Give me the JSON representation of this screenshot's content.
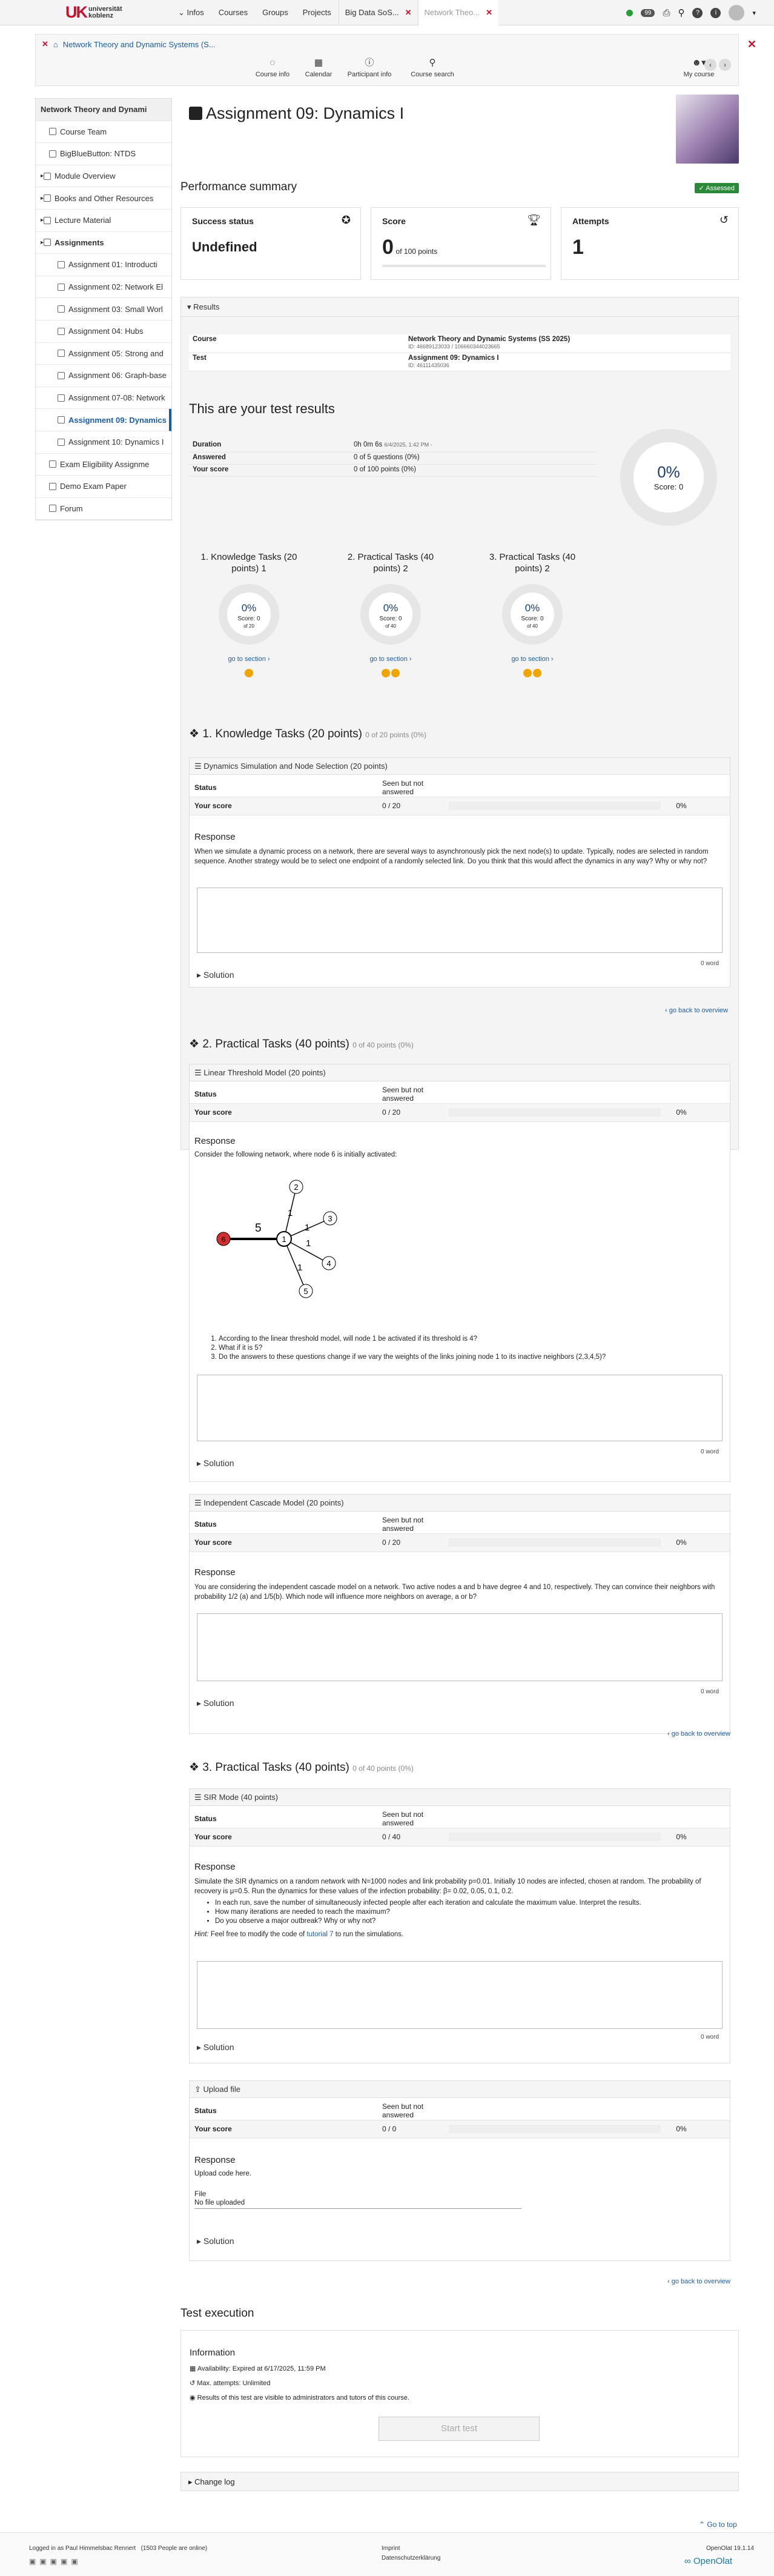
{
  "topbar": {
    "logo_mark": "UK",
    "logo_line1": "universität",
    "logo_line2": "koblenz",
    "nav": [
      "Infos",
      "Courses",
      "Groups",
      "Projects"
    ],
    "tabs": [
      "Big Data SoS...",
      "Network Theo..."
    ],
    "count_badge": "99"
  },
  "crumb": {
    "title": "Network Theory and Dynamic Systems (S..."
  },
  "tools": [
    {
      "icon": "bulb-icon",
      "label": "Course info"
    },
    {
      "icon": "calendar-icon",
      "label": "Calendar"
    },
    {
      "icon": "info-icon",
      "label": "Participant info"
    },
    {
      "icon": "search-icon",
      "label": "Course search"
    }
  ],
  "my_course": "My course",
  "sidebar": [
    {
      "label": "Network Theory and Dynami",
      "indent": 0,
      "head": true
    },
    {
      "label": "Course Team",
      "indent": 1
    },
    {
      "label": "BigBlueButton: NTDS",
      "indent": 1
    },
    {
      "label": "Module Overview",
      "indent": 0,
      "arrow": true
    },
    {
      "label": "Books and Other Resources",
      "indent": 0,
      "arrow": true
    },
    {
      "label": "Lecture Material",
      "indent": 0,
      "arrow": true
    },
    {
      "label": "Assignments",
      "indent": 0,
      "arrow": true,
      "bold": true
    },
    {
      "label": "Assignment 01: Introducti",
      "indent": 2
    },
    {
      "label": "Assignment 02: Network El",
      "indent": 2
    },
    {
      "label": "Assignment 03: Small Worl",
      "indent": 2
    },
    {
      "label": "Assignment 04: Hubs",
      "indent": 2
    },
    {
      "label": "Assignment 05: Strong and",
      "indent": 2
    },
    {
      "label": "Assignment 06: Graph-base",
      "indent": 2
    },
    {
      "label": "Assignment 07-08: Network",
      "indent": 2
    },
    {
      "label": "Assignment 09: Dynamics I",
      "indent": 2,
      "active": true
    },
    {
      "label": "Assignment 10: Dynamics I",
      "indent": 2
    },
    {
      "label": "Exam Eligibility Assignme",
      "indent": 1
    },
    {
      "label": "Demo Exam Paper",
      "indent": 1
    },
    {
      "label": "Forum",
      "indent": 1
    }
  ],
  "page": {
    "title": "Assignment 09: Dynamics I",
    "perf_summary": "Performance summary",
    "assessed": "✓ Assessed",
    "success_label": "Success status",
    "success_value": "Undefined",
    "score_label": "Score",
    "score_value": "0",
    "score_of": "of 100 points",
    "attempts_label": "Attempts",
    "attempts_value": "1",
    "results_label": "Results",
    "course_k": "Course",
    "course_v": "Network Theory and Dynamic Systems (SS 2025)",
    "course_id": "ID: 46689123033 / 106660344023665",
    "test_k": "Test",
    "test_v": "Assignment 09: Dynamics I",
    "test_id": "ID: 46111435036",
    "your_results": "This are your test results",
    "duration_k": "Duration",
    "duration_v": "0h 0m 6s",
    "duration_d": "6/4/2025, 1:42 PM -",
    "answered_k": "Answered",
    "answered_v": "0 of 5 questions (0%)",
    "yourscore_k": "Your score",
    "yourscore_v": "0 of 100 points (0%)",
    "big_pct": "0%",
    "big_score": "Score: 0"
  },
  "sections": [
    {
      "title": "1. Knowledge Tasks (20 points) 1",
      "pct": "0%",
      "score": "Score: 0",
      "of": "of 20",
      "link": "go to section",
      "dots": 1
    },
    {
      "title": "2. Practical Tasks (40 points) 2",
      "pct": "0%",
      "score": "Score: 0",
      "of": "of 40",
      "link": "go to section",
      "dots": 2
    },
    {
      "title": "3. Practical Tasks (40 points) 2",
      "pct": "0%",
      "score": "Score: 0",
      "of": "of 40",
      "link": "go to section",
      "dots": 2
    }
  ],
  "common": {
    "status_k": "Status",
    "status_v": "Seen but not answered",
    "yourscore_k": "Your score",
    "pct": "0%",
    "response": "Response",
    "words": "0 word",
    "solution": "Solution",
    "back": "go back to overview"
  },
  "s1": {
    "title": "1. Knowledge Tasks (20 points)",
    "sub": "0 of 20 points (0%)",
    "q1_title": "Dynamics Simulation and Node Selection (20 points)",
    "q1_score": "0 / 20",
    "q1_text": "When we simulate a dynamic process on a network, there are several ways to asynchronously pick the next node(s) to update. Typically, nodes are selected in random sequence. Another strategy would be to select one endpoint of a randomly selected link. Do you think that this would affect the dynamics in any way? Why or why not?"
  },
  "s2": {
    "title": "2. Practical Tasks (40 points)",
    "sub": "0 of 40 points (0%)",
    "q2_title": "Linear Threshold Model (20 points)",
    "q2_score": "0 / 20",
    "q2_text": "Consider the following network, where node 6 is initially activated:",
    "graph": {
      "edge_a": "5",
      "edge_b": "1",
      "edge_c": "1",
      "edge_d": "1",
      "edge_e": "1",
      "n1": "1",
      "n2": "2",
      "n3": "3",
      "n4": "4",
      "n5": "5",
      "n6": "6"
    },
    "q2_list": [
      "According to the linear threshold model, will node 1 be activated if its threshold is 4?",
      "What if it is 5?",
      "Do the answers to these questions change if we vary the weights of the links joining node 1 to its inactive neighbors (2,3,4,5)?"
    ],
    "q3_title": "Independent Cascade Model (20 points)",
    "q3_score": "0 / 20",
    "q3_text": "You are considering the independent cascade model on a network. Two active nodes a and b have degree 4 and 10, respectively. They can convince their neighbors with probability  1/2 (a) and 1/5(b). Which node will influence more neighbors on average, a or b?"
  },
  "s3": {
    "title": "3. Practical Tasks (40 points)",
    "sub": "0 of 40 points (0%)",
    "q4_title": "SIR Mode (40 points)",
    "q4_score": "0 / 40",
    "q4_text": "Simulate the SIR dynamics on a random network with N=1000 nodes and link probability p=0.01. Initially 10 nodes are infected, chosen at random. The probability of recovery is μ=0.5. Run the dynamics for these values of the infection probability: β= 0.02, 0.05, 0.1, 0.2.",
    "q4_list": [
      "In each run, save the number of simultaneously infected people after each iteration and calculate the maximum value. Interpret the results.",
      "How many iterations are needed to reach the maximum?",
      "Do you observe a major outbreak? Why or why not?"
    ],
    "hint_a": "Hint:",
    "hint_b": " Feel free to modify the code of ",
    "hint_link": "tutorial 7",
    "hint_c": " to run the simulations.",
    "q5_title": "Upload file",
    "q5_score": "0 / 0",
    "q5_text": "Upload code here.",
    "file_k": "File",
    "file_v": "No file uploaded"
  },
  "exec": {
    "title": "Test execution",
    "info": "Information",
    "avail": "Availability: Expired at 6/17/2025, 11:59 PM",
    "attempts": "Max. attempts: Unlimited",
    "visible": "Results of this test are visible to administrators and tutors of this course.",
    "start": "Start test",
    "changelog": "Change log",
    "gotop": "Go to top"
  },
  "footer": {
    "logged": "Logged in as Paul Himmelsbac Rennert",
    "people": "(1503 People are online)",
    "impr": "Imprint",
    "privacy": "Datenschutzerklärung",
    "version": "OpenOlat 19.1.14",
    "brand": "OpenOlat"
  }
}
